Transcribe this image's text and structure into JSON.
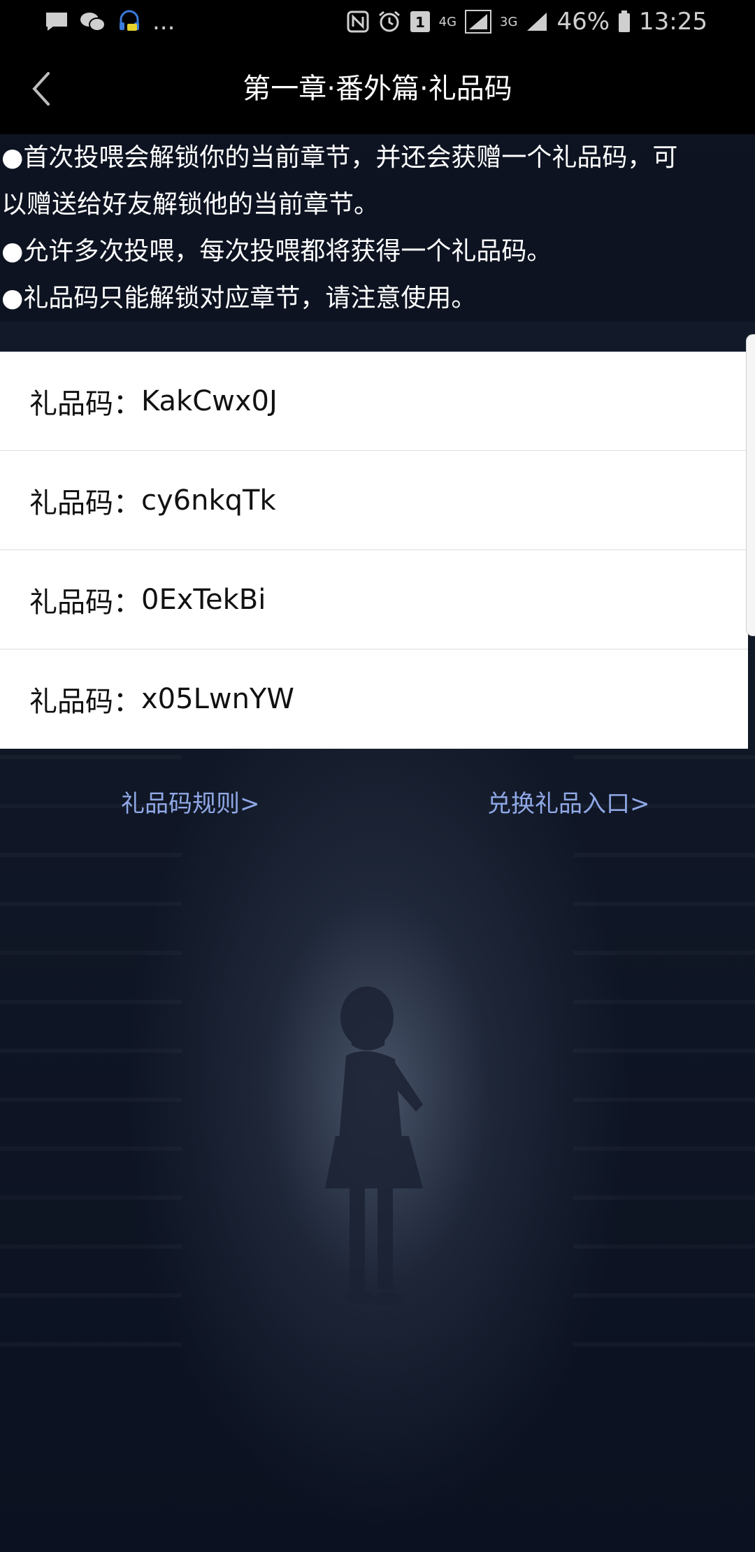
{
  "status_bar": {
    "more_indicator": "...",
    "battery_percent": "46%",
    "time": "13:25",
    "network_1": "4G",
    "network_2": "3G",
    "sim_number": "1",
    "icons": [
      "message-icon",
      "wechat-icon",
      "headset-icon",
      "nfc-icon",
      "alarm-icon",
      "sim-icon",
      "signal-icon",
      "battery-icon"
    ]
  },
  "header": {
    "title": "第一章·番外篇·礼品码"
  },
  "rules": {
    "lines": [
      "●首次投喂会解锁你的当前章节，并还会获赠一个礼品码，可",
      "以赠送给好友解锁他的当前章节。",
      "●允许多次投喂，每次投喂都将获得一个礼品码。",
      "●礼品码只能解锁对应章节，请注意使用。"
    ]
  },
  "codes": {
    "label": "礼品码：",
    "items": [
      {
        "value": "KakCwx0J"
      },
      {
        "value": "cy6nkqTk"
      },
      {
        "value": "0ExTekBi"
      },
      {
        "value": "x05LwnYW"
      }
    ]
  },
  "links": {
    "rules_label": "礼品码规则>",
    "redeem_label": "兑换礼品入口>"
  },
  "colors": {
    "link": "#8fa8e6",
    "header_bg": "#000000",
    "list_bg": "#ffffff"
  }
}
